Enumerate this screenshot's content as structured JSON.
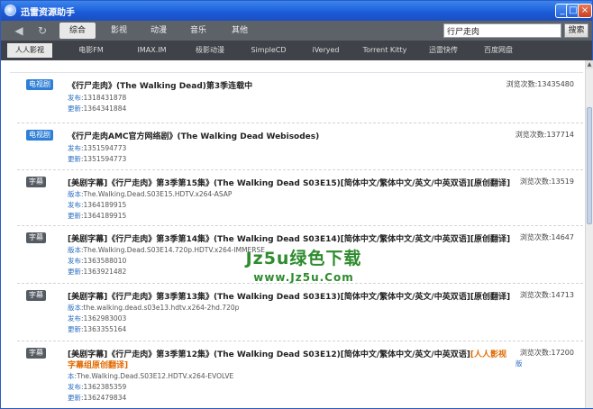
{
  "titlebar": {
    "title": "迅雷资源助手"
  },
  "toolbar": {
    "categories": [
      "综合",
      "影视",
      "动漫",
      "音乐",
      "其他"
    ],
    "search_value": "行尸走肉",
    "search_button": "搜索"
  },
  "sources": [
    "人人影视",
    "电影FM",
    "IMAX.IM",
    "极影动漫",
    "SimpleCD",
    "iVeryed",
    "Torrent Kitty",
    "迅雷快传",
    "百度网盘"
  ],
  "labels": {
    "publish": "发布",
    "update": "更新",
    "version": "版本",
    "partial_version": "本"
  },
  "items": [
    {
      "badge": "电视剧",
      "title": "《行尸走肉》(The Walking Dead)第3季连载中",
      "views": "浏览次数:13435480",
      "publish": ":1318431878",
      "update": ":1364341884"
    },
    {
      "badge": "电视剧",
      "title": "《行尸走肉AMC官方网络剧》(The Walking Dead Webisodes)",
      "views": "浏览次数:137714",
      "publish": ":1351594773",
      "update": ":1351594773"
    },
    {
      "badge": "字幕",
      "title": "[美剧字幕]《行尸走肉》第3季第15集》(The Walking Dead S03E15)[简体中文/繁体中文/英文/中英双语][原创翻译]",
      "views": "浏览次数:13519",
      "version": ":The.Walking.Dead.S03E15.HDTV.x264-ASAP",
      "publish": ":1364189915",
      "update": ":1364189915"
    },
    {
      "badge": "字幕",
      "title": "[美剧字幕]《行尸走肉》第3季第14集》(The Walking Dead S03E14)[简体中文/繁体中文/英文/中英双语][原创翻译]",
      "views": "浏览次数:14647",
      "version": ":The.Walking.Dead.S03E14.720p.HDTV.x264-IMMERSE",
      "publish": ":1363588010",
      "update": ":1363921482"
    },
    {
      "badge": "字幕",
      "title": "[美剧字幕]《行尸走肉》第3季第13集》(The Walking Dead S03E13)[简体中文/繁体中文/英文/中英双语][原创翻译]",
      "views": "浏览次数:14713",
      "version": ":the.walking.dead.s03e13.hdtv.x264-2hd.720p",
      "publish": ":1362983003",
      "update": ":1363355164"
    },
    {
      "badge": "字幕",
      "title": "[美剧字幕]《行尸走肉》第3季第12集》(The Walking Dead S03E12)[简体中文/繁体中文/英文/中英双语]",
      "title_highlight": "[人人影视",
      "title_line2": "字幕组原创翻译]",
      "views": "浏览次数:17200",
      "version_suffix": "版",
      "version": ":The.Walking.Dead.S03E12.HDTV.x264-EVOLVE",
      "publish": ":1362385359",
      "update": ":1362479834"
    }
  ],
  "watermark": {
    "main": "Jz5u绿色下载",
    "sub": "www.Jz5u.Com"
  }
}
